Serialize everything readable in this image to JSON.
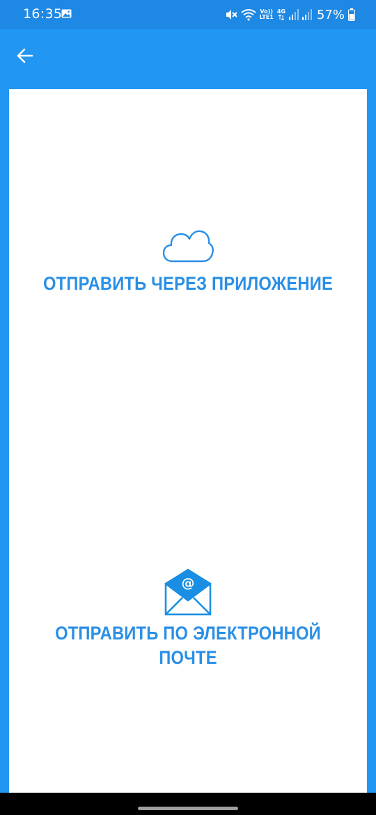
{
  "status_bar": {
    "time": "16:35",
    "volte_top": "Vo))",
    "volte_bottom": "LTE1",
    "network_type": "4G",
    "battery_percent": "57%"
  },
  "app_bar": {
    "back_icon": "arrow-left-icon"
  },
  "options": {
    "send_via_app": {
      "icon": "cloud-icon",
      "label": "ОТПРАВИТЬ ЧЕРЕЗ ПРИЛОЖЕНИЕ"
    },
    "send_via_email": {
      "icon": "email-envelope-icon",
      "label_line1": "ОТПРАВИТЬ ПО ЭЛЕКТРОННОЙ",
      "label_line2": "ПОЧТЕ",
      "envelope_symbol": "@"
    }
  },
  "colors": {
    "primary": "#2196f3",
    "status_bar": "#1e88e5",
    "accent_text": "#2a8fe6",
    "card": "#ffffff"
  }
}
